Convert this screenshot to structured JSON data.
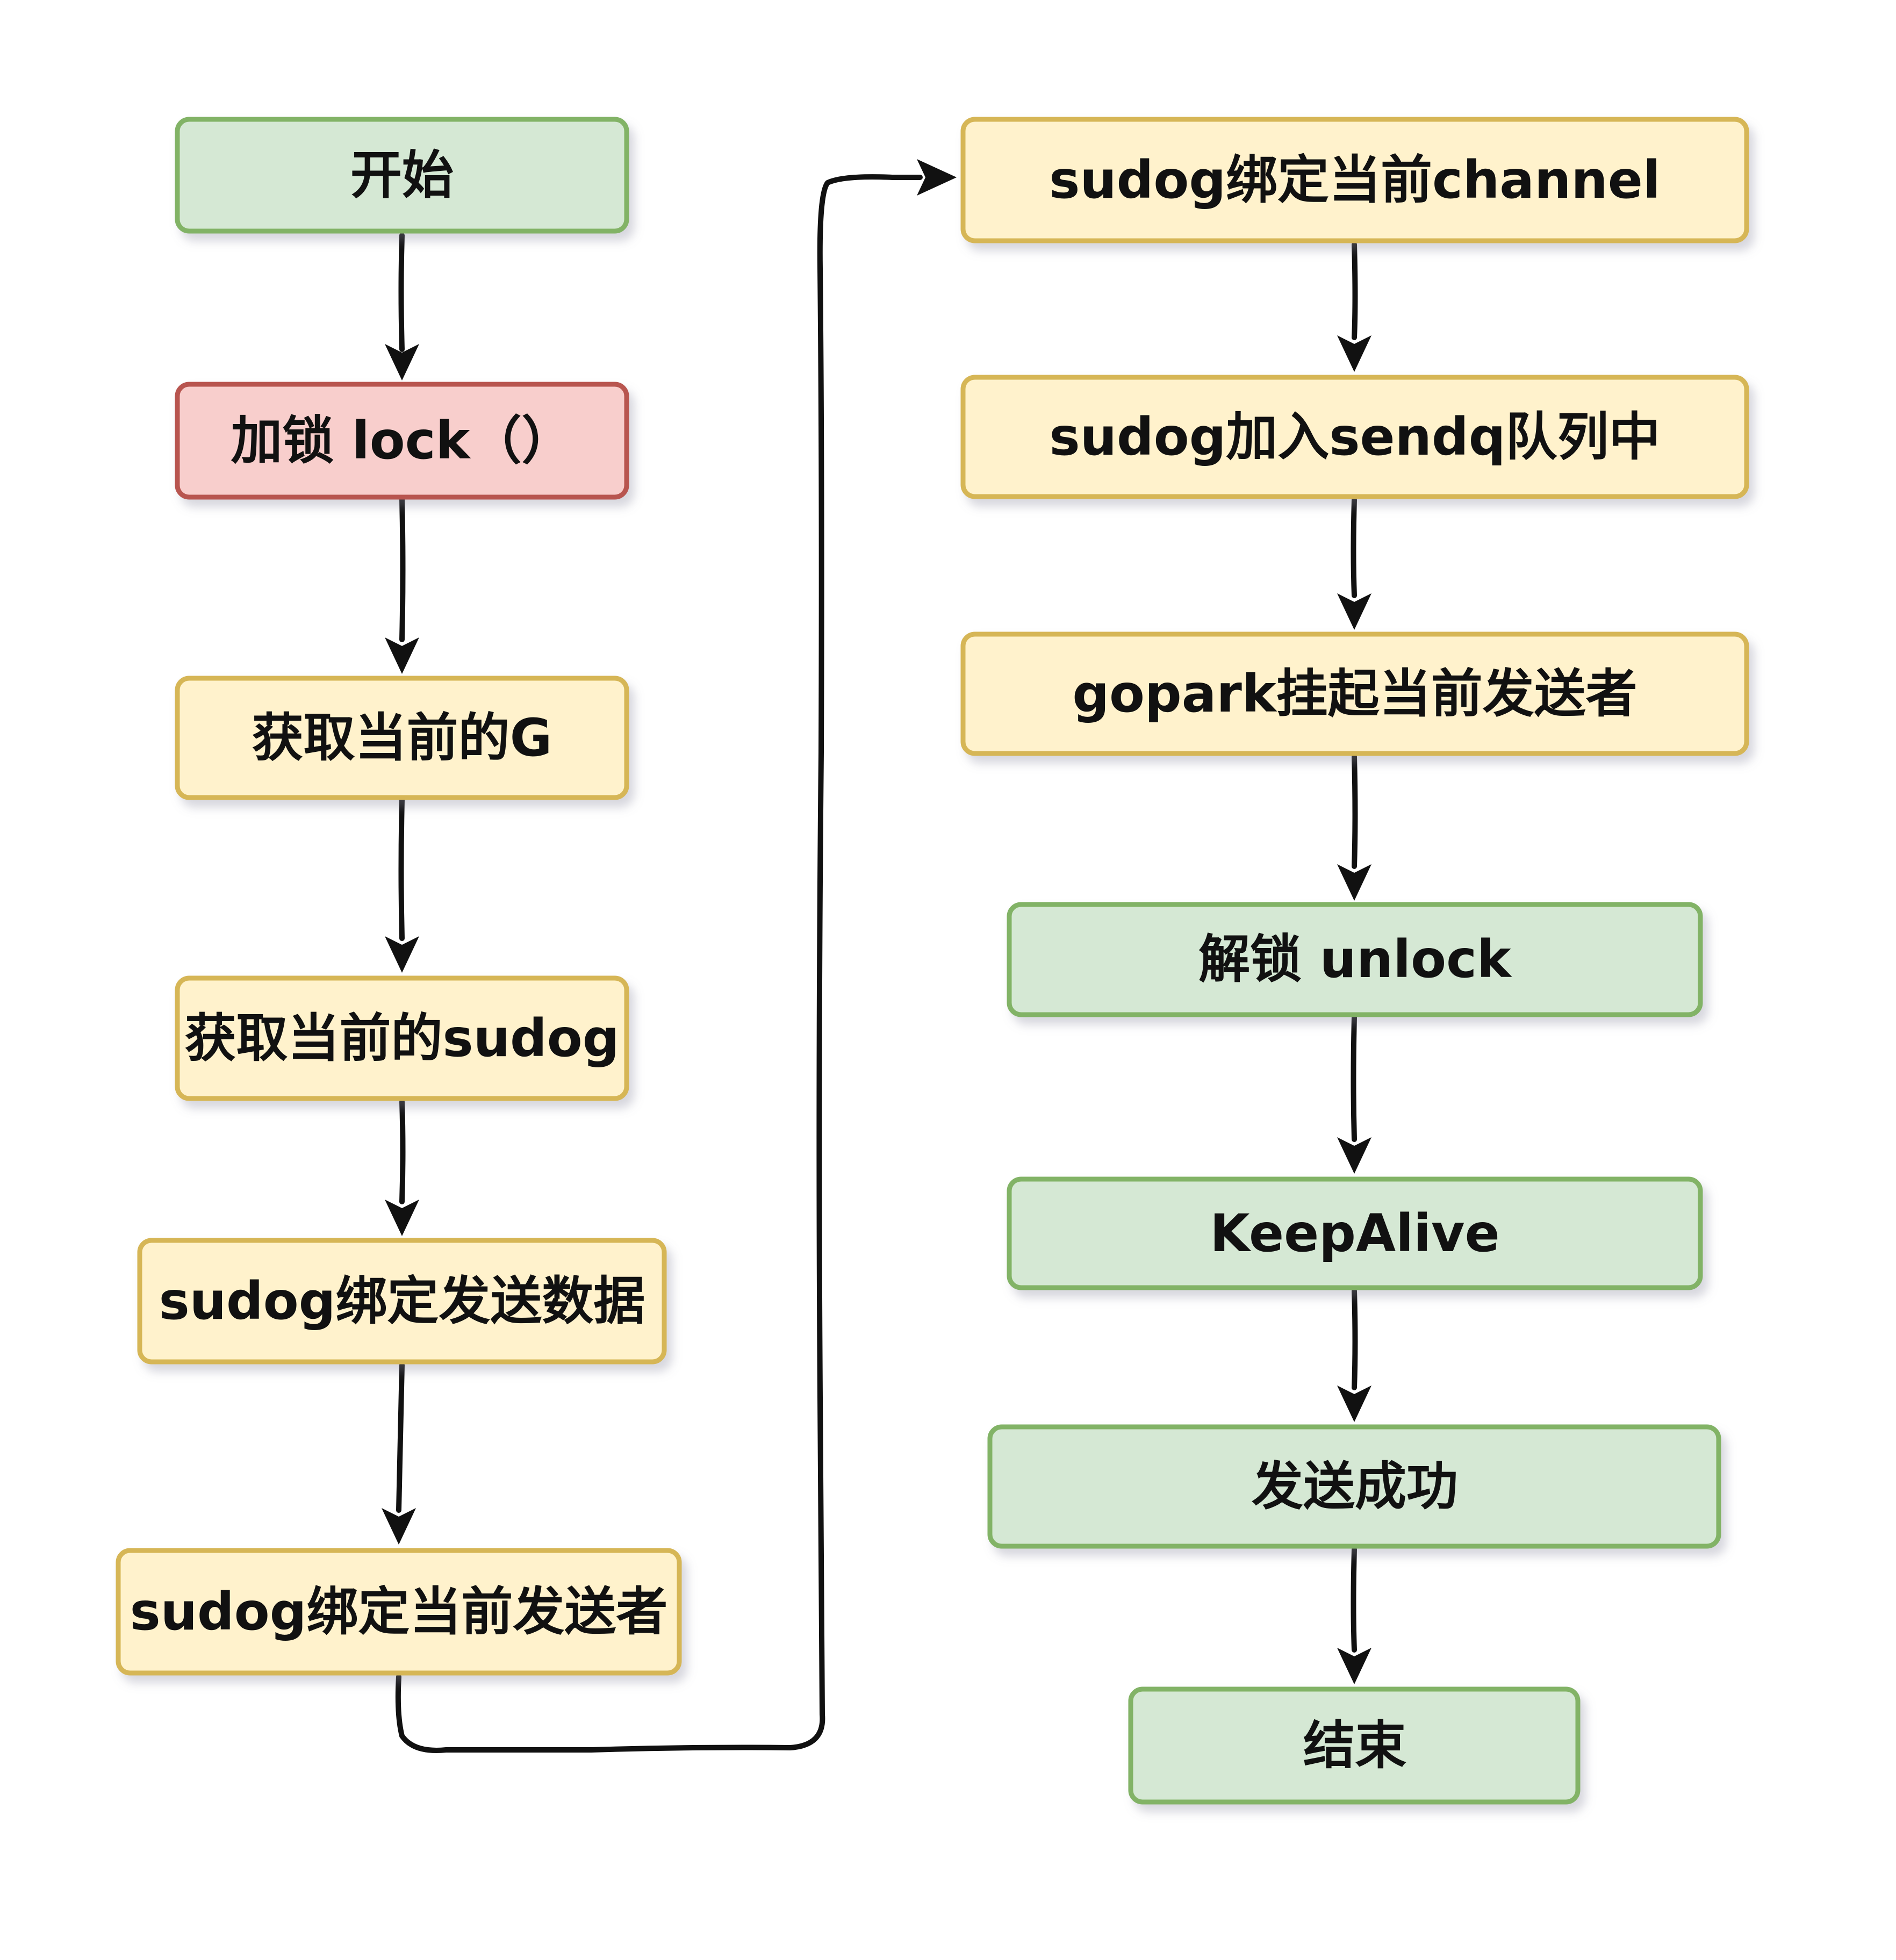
{
  "colors": {
    "green_fill": "#d5e8d4",
    "green_stroke": "#82b366",
    "red_fill": "#f8cecc",
    "red_stroke": "#b85450",
    "yellow_fill": "#fff2cc",
    "yellow_stroke": "#d6b656",
    "arrow": "#111111"
  },
  "nodes": {
    "start": {
      "label": "开始",
      "color": "green"
    },
    "lock": {
      "label": "加锁 lock（）",
      "color": "red"
    },
    "get_g": {
      "label": "获取当前的G",
      "color": "yellow"
    },
    "get_sudog": {
      "label": "获取当前的sudog",
      "color": "yellow"
    },
    "bind_data": {
      "label": "sudog绑定发送数据",
      "color": "yellow"
    },
    "bind_sender": {
      "label": "sudog绑定当前发送者",
      "color": "yellow"
    },
    "bind_channel": {
      "label": "sudog绑定当前channel",
      "color": "yellow"
    },
    "enqueue": {
      "label": "sudog加入sendq队列中",
      "color": "yellow"
    },
    "gopark": {
      "label": "gopark挂起当前发送者",
      "color": "yellow"
    },
    "unlock": {
      "label": "解锁 unlock",
      "color": "green"
    },
    "keepalive": {
      "label": "KeepAlive",
      "color": "green"
    },
    "success": {
      "label": "发送成功",
      "color": "green"
    },
    "end": {
      "label": "结束",
      "color": "green"
    }
  },
  "edges": [
    {
      "from": "start",
      "to": "lock"
    },
    {
      "from": "lock",
      "to": "get_g"
    },
    {
      "from": "get_g",
      "to": "get_sudog"
    },
    {
      "from": "get_sudog",
      "to": "bind_data"
    },
    {
      "from": "bind_data",
      "to": "bind_sender"
    },
    {
      "from": "bind_sender",
      "to": "bind_channel"
    },
    {
      "from": "bind_channel",
      "to": "enqueue"
    },
    {
      "from": "enqueue",
      "to": "gopark"
    },
    {
      "from": "gopark",
      "to": "unlock"
    },
    {
      "from": "unlock",
      "to": "keepalive"
    },
    {
      "from": "keepalive",
      "to": "success"
    },
    {
      "from": "success",
      "to": "end"
    }
  ]
}
